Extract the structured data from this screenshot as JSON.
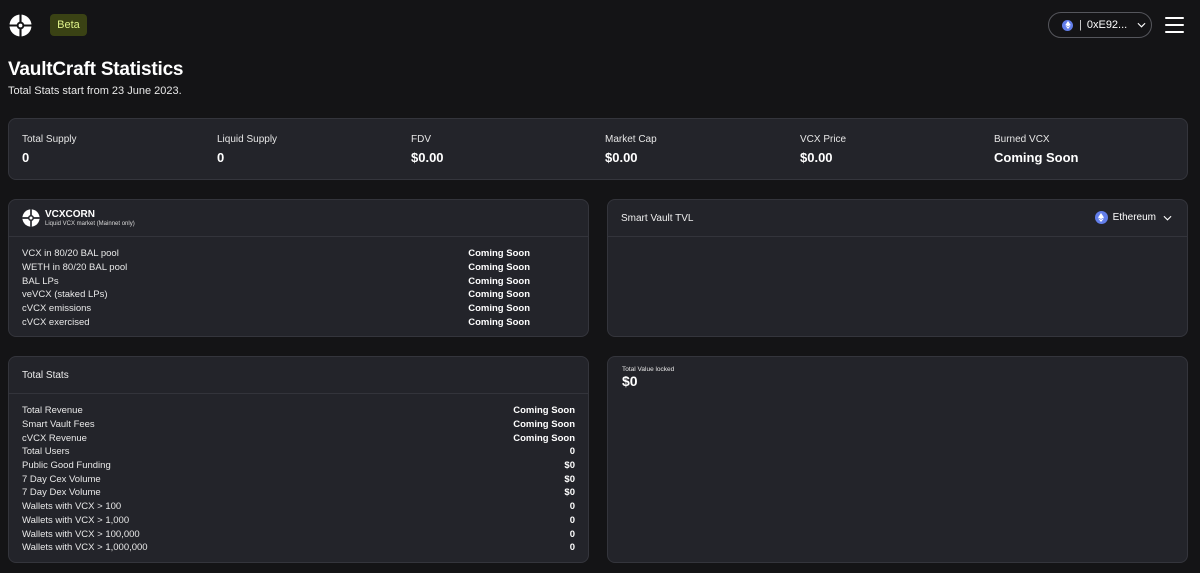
{
  "header": {
    "beta_label": "Beta",
    "wallet_label": "0xE92...",
    "wallet_separator": "|"
  },
  "page": {
    "title": "VaultCraft Statistics",
    "subtitle": "Total Stats start from 23 June 2023."
  },
  "stats": [
    {
      "label": "Total Supply",
      "value": "0"
    },
    {
      "label": "Liquid Supply",
      "value": "0"
    },
    {
      "label": "FDV",
      "value": "$0.00"
    },
    {
      "label": "Market Cap",
      "value": "$0.00"
    },
    {
      "label": "VCX Price",
      "value": "$0.00"
    },
    {
      "label": "Burned VCX",
      "value": "Coming Soon"
    }
  ],
  "vcxcorn": {
    "name": "VCXCORN",
    "subtitle": "Liquid VCX market (Mainnet only)",
    "rows": [
      {
        "label": "VCX in 80/20 BAL pool",
        "value": "Coming Soon"
      },
      {
        "label": "WETH in 80/20 BAL pool",
        "value": "Coming Soon"
      },
      {
        "label": "BAL LPs",
        "value": "Coming Soon"
      },
      {
        "label": "veVCX (staked LPs)",
        "value": "Coming Soon"
      },
      {
        "label": "cVCX emissions",
        "value": "Coming Soon"
      },
      {
        "label": "cVCX exercised",
        "value": "Coming Soon"
      }
    ]
  },
  "tvl": {
    "title": "Smart Vault TVL",
    "network": "Ethereum"
  },
  "total_stats": {
    "title": "Total Stats",
    "rows": [
      {
        "label": "Total Revenue",
        "value": "Coming Soon"
      },
      {
        "label": "Smart Vault Fees",
        "value": "Coming Soon"
      },
      {
        "label": "cVCX Revenue",
        "value": "Coming Soon"
      },
      {
        "label": "Total Users",
        "value": "0"
      },
      {
        "label": "Public Good Funding",
        "value": "$0"
      },
      {
        "label": "7 Day Cex Volume",
        "value": "$0"
      },
      {
        "label": "7 Day Dex Volume",
        "value": "$0"
      },
      {
        "label": "Wallets with VCX > 100",
        "value": "0"
      },
      {
        "label": "Wallets with VCX > 1,000",
        "value": "0"
      },
      {
        "label": "Wallets with VCX > 100,000",
        "value": "0"
      },
      {
        "label": "Wallets with VCX > 1,000,000",
        "value": "0"
      }
    ]
  },
  "locked": {
    "label": "Total Value locked",
    "value": "$0"
  },
  "icons": {
    "logo": "vaultcraft-logo-icon",
    "network": "ethereum-icon",
    "menu": "hamburger-menu-icon",
    "dropdown": "chevron-down-icon"
  },
  "colors": {
    "background": "#141416",
    "card": "#23242a",
    "beta_bg": "#3a4214",
    "beta_text": "#dff28a",
    "ethereum": "#627eea"
  }
}
